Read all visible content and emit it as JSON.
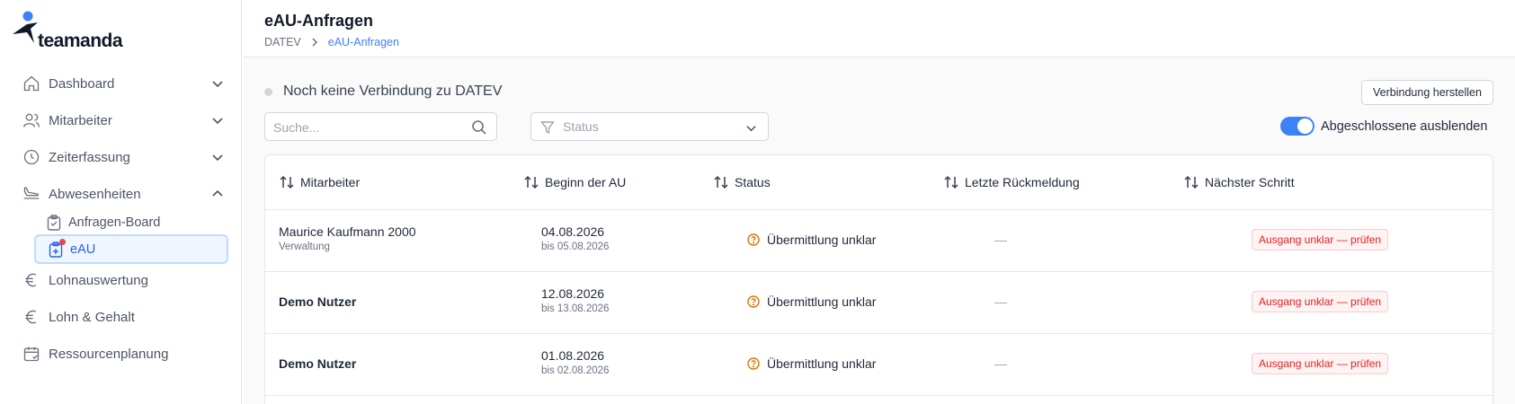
{
  "app": {
    "brand": "teamanda"
  },
  "sidebar": {
    "items": [
      {
        "label": "Dashboard",
        "icon": "home-icon",
        "expanded": false
      },
      {
        "label": "Mitarbeiter",
        "icon": "users-icon",
        "expanded": false
      },
      {
        "label": "Zeiterfassung",
        "icon": "clock-icon",
        "expanded": false
      },
      {
        "label": "Abwesenheiten",
        "icon": "plane-icon",
        "expanded": true
      },
      {
        "label": "Lohnauswertung",
        "icon": "euro-icon"
      },
      {
        "label": "Lohn & Gehalt",
        "icon": "euro-icon"
      },
      {
        "label": "Ressourcenplanung",
        "icon": "calendar-icon"
      }
    ],
    "subitems": [
      {
        "label": "Anfragen-Board",
        "icon": "clipboard-icon",
        "active": false
      },
      {
        "label": "eAU",
        "icon": "medical-clipboard-icon",
        "active": true,
        "notification": true
      }
    ]
  },
  "header": {
    "title": "eAU-Anfragen",
    "breadcrumb": {
      "root": "DATEV",
      "current": "eAU-Anfragen"
    }
  },
  "connection": {
    "status_text": "Noch keine Verbindung zu DATEV",
    "button_label": "Verbindung herstellen"
  },
  "filters": {
    "search_placeholder": "Suche...",
    "status_placeholder": "Status",
    "toggle_label": "Abgeschlossene ausblenden",
    "toggle_on": true
  },
  "table": {
    "columns": [
      "Mitarbeiter",
      "Beginn der AU",
      "Status",
      "Letzte Rückmeldung",
      "Nächster Schritt"
    ],
    "rows": [
      {
        "name": "Maurice Kaufmann 2000",
        "department": "Verwaltung",
        "start": "04.08.2026",
        "until": "bis 05.08.2026",
        "status": "Übermittlung unklar",
        "last_response": "—",
        "next_step": "Ausgang unklar — prüfen"
      },
      {
        "name": "Demo Nutzer",
        "department": "",
        "start": "12.08.2026",
        "until": "bis 13.08.2026",
        "status": "Übermittlung unklar",
        "last_response": "—",
        "next_step": "Ausgang unklar — prüfen"
      },
      {
        "name": "Demo Nutzer",
        "department": "",
        "start": "01.08.2026",
        "until": "bis 02.08.2026",
        "status": "Übermittlung unklar",
        "last_response": "—",
        "next_step": "Ausgang unklar — prüfen"
      }
    ]
  },
  "colors": {
    "accent": "#3b82f6",
    "warning": "#d97706",
    "danger": "#dc2626"
  }
}
